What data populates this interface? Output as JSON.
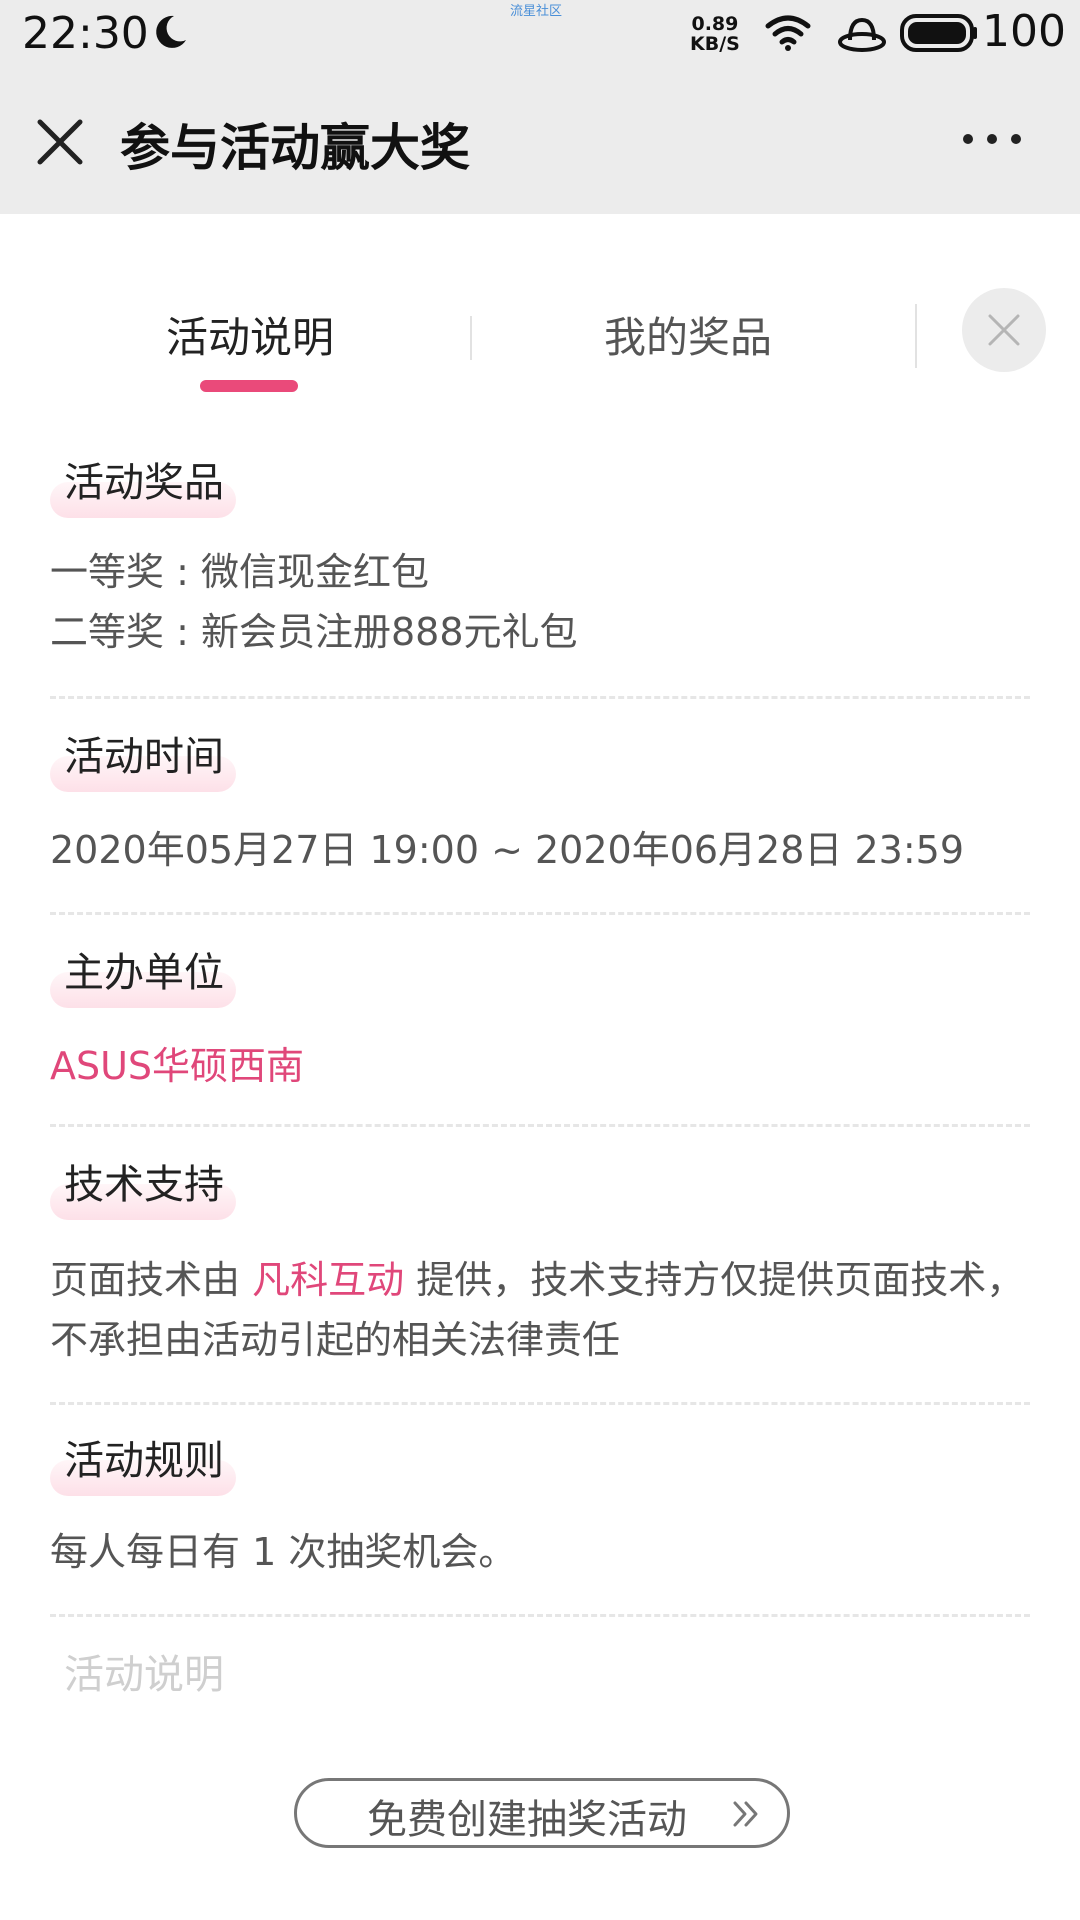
{
  "status_bar": {
    "time": "22:30",
    "center_text": "流星社区",
    "net_speed_value": "0.89",
    "net_speed_unit": "KB/S",
    "battery_level": "100",
    "icons": [
      "moon-icon",
      "wifi-icon",
      "hat-icon",
      "battery-icon"
    ]
  },
  "title_bar": {
    "title": "参与活动赢大奖",
    "icons": [
      "close-icon",
      "more-icon"
    ]
  },
  "tabs": {
    "active": "活动说明",
    "items": [
      "活动说明",
      "我的奖品"
    ],
    "accent_color": "#ea4a7a"
  },
  "sections": {
    "prizes": {
      "label": "活动奖品",
      "line1": "一等奖 : 微信现金红包",
      "line2": "二等奖 : 新会员注册888元礼包"
    },
    "time": {
      "label": "活动时间",
      "text": "2020年05月27日 19:00 ~ 2020年06月28日 23:59"
    },
    "organizer": {
      "label": "主办单位",
      "text": "ASUS华硕西南"
    },
    "tech": {
      "label": "技术支持",
      "prefix": "页面技术由 ",
      "link": "凡科互动",
      "suffix": " 提供，技术支持方仅提供页面技术，不承担由活动引起的相关法律责任"
    },
    "rules": {
      "label": "活动规则",
      "text": "每人每日有 1 次抽奖机会。"
    },
    "description": {
      "label": "活动说明"
    }
  },
  "create_button": {
    "label": "免费创建抽奖活动",
    "icon": "double-chevron-right-icon"
  }
}
